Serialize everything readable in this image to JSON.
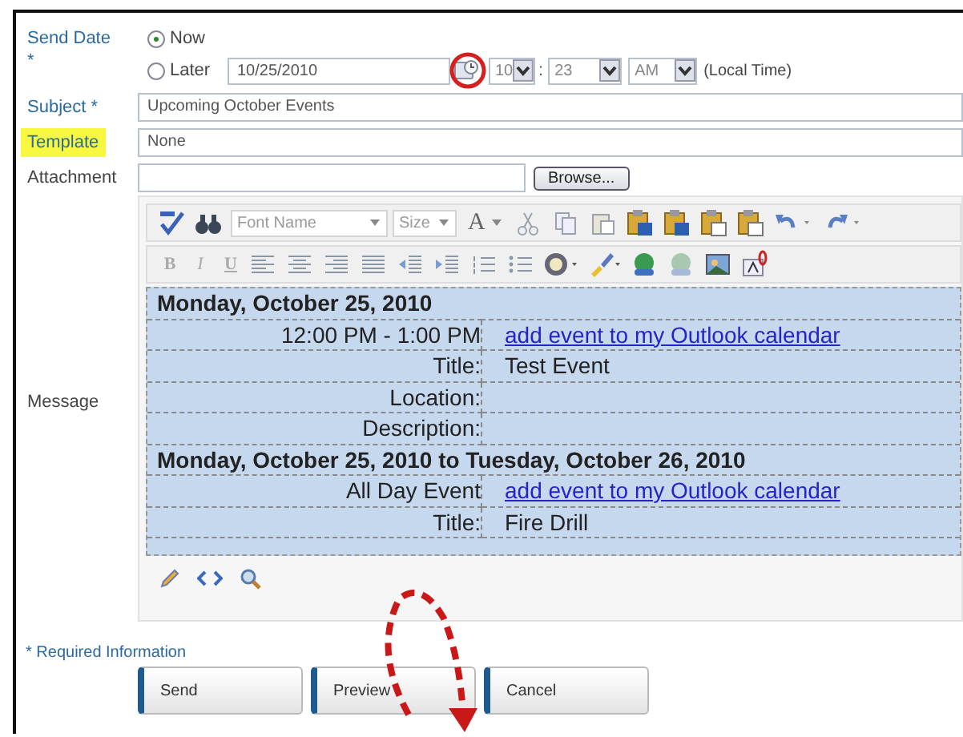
{
  "send_date": {
    "label": "Send Date",
    "required_mark": "*",
    "options": [
      {
        "label": "Now",
        "selected": true
      },
      {
        "label": "Later",
        "selected": false
      }
    ],
    "date": "10/25/2010",
    "hour": "10",
    "separator": ":",
    "minute": "23",
    "ampm": "AM",
    "timezone_note": "(Local Time)"
  },
  "subject": {
    "label": "Subject *",
    "value": "Upcoming October Events"
  },
  "template": {
    "label": "Template",
    "highlighted": true,
    "value": "None"
  },
  "attachment": {
    "label": "Attachment",
    "button": "Browse..."
  },
  "message": {
    "label": "Message",
    "toolbar": {
      "font_name": "Font Name",
      "size": "Size",
      "font_color": "A",
      "format": [
        "B",
        "I",
        "U"
      ]
    },
    "events": [
      {
        "heading": "Monday, October 25, 2010",
        "rows": [
          {
            "label": "12:00 PM - 1:00 PM",
            "value": "add event to my Outlook calendar",
            "kind": "link"
          },
          {
            "label": "Title:",
            "value": "Test Event",
            "kind": "text"
          },
          {
            "label": "Location:"
          },
          {
            "label": "Description:"
          }
        ]
      },
      {
        "heading": "Monday, October 25, 2010 to Tuesday, October 26, 2010",
        "rows": [
          {
            "label": "All Day Event",
            "value": "add event to my Outlook calendar",
            "kind": "link"
          },
          {
            "label": "Title:",
            "value": "Fire Drill",
            "kind": "text"
          }
        ]
      }
    ]
  },
  "required_note": "* Required Information",
  "buttons": [
    "Send",
    "Preview",
    "Cancel"
  ]
}
